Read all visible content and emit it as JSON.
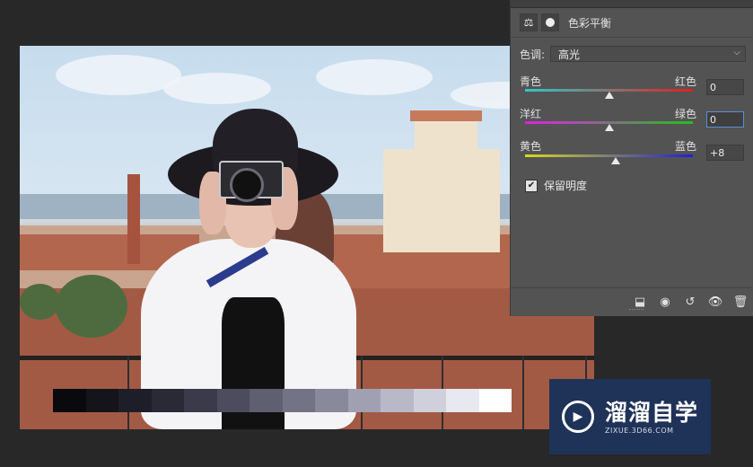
{
  "panel": {
    "title": "色彩平衡",
    "icons": [
      "balance-scale-icon",
      "mask-icon"
    ],
    "tone": {
      "label": "色调:",
      "value": "高光",
      "options": [
        "高光"
      ]
    },
    "sliders": [
      {
        "left": "青色",
        "right": "红色",
        "value": "0",
        "level": 0.5,
        "gradient": [
          "#2ec8c6",
          "#e02020"
        ]
      },
      {
        "left": "洋红",
        "right": "绿色",
        "value": "0",
        "level": 0.5,
        "gradient": [
          "#e020e0",
          "#20c020"
        ]
      },
      {
        "left": "黄色",
        "right": "蓝色",
        "value": "+8",
        "level": 0.54,
        "gradient": [
          "#d8d820",
          "#2020d8"
        ]
      }
    ],
    "preserve_luminosity": {
      "label": "保留明度",
      "checked": true
    },
    "footer_icons": [
      "clip-to-layer-icon",
      "view-previous-icon",
      "reset-icon",
      "visibility-icon",
      "trash-icon"
    ]
  },
  "watermark": {
    "brand": "溜溜自学",
    "url": "ZIXUE.3D66.COM"
  },
  "grayscale_strip": [
    "#0a0a0e",
    "#14141a",
    "#1e1e28",
    "#2a2a36",
    "#3a3a4a",
    "#4c4c5e",
    "#5f5f72",
    "#737386",
    "#89899c",
    "#a0a0b2",
    "#b8b8c8",
    "#d0d0dc",
    "#e8e8f0",
    "#ffffff"
  ]
}
